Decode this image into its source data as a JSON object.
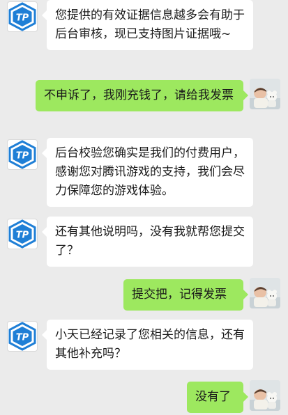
{
  "messages": [
    {
      "sender": "tencent-service",
      "text": "您提供的有效证据信息越多会有助于后台审核，现已支持图片证据哦~"
    },
    {
      "sender": "user",
      "text": "不申诉了，我刚充钱了，请给我发票"
    },
    {
      "sender": "tencent-service",
      "text": "后台校验您确实是我们的付费用户，感谢您对腾讯游戏的支持，我们会尽力保障您的游戏体验。"
    },
    {
      "sender": "tencent-service",
      "text": "还有其他说明吗，没有我就帮您提交了？"
    },
    {
      "sender": "user",
      "text": "提交把，记得发票"
    },
    {
      "sender": "tencent-service",
      "text": "小天已经记录了您相关的信息，还有其他补充吗？"
    },
    {
      "sender": "user",
      "text": "没有了"
    }
  ],
  "avatars": {
    "service_logo_text": "TP",
    "service_logo_color": "#1f7fd6",
    "user_photo_icon": "baby-with-toy-photo"
  },
  "colors": {
    "background": "#ebebeb",
    "incoming_bubble": "#ffffff",
    "outgoing_bubble": "#9de85f"
  }
}
